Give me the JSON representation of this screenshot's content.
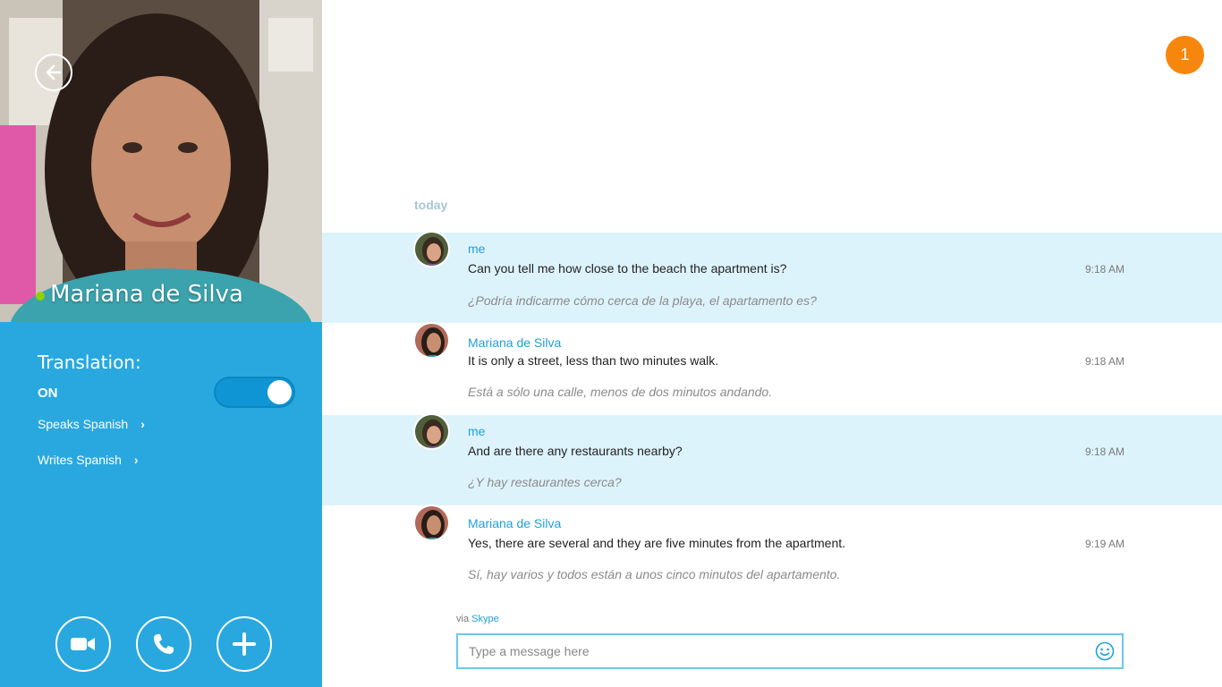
{
  "contact": {
    "name": "Mariana de Silva",
    "presence_color": "#8ed100"
  },
  "translation": {
    "label": "Translation:",
    "state_label": "ON",
    "enabled": true,
    "speaks_label": "Speaks Spanish",
    "writes_label": "Writes Spanish"
  },
  "notifications": {
    "count": "1"
  },
  "conversation": {
    "date_separator": "today",
    "messages": [
      {
        "sender": "me",
        "text": "Can you tell me how close to the beach the apartment is?",
        "translation": "¿Podría indicarme cómo cerca de la playa, el apartamento es?",
        "time": "9:18 AM"
      },
      {
        "sender": "Mariana de Silva",
        "text": "It is only a street, less than two minutes walk.",
        "translation": "Está a sólo una calle, menos de dos minutos andando.",
        "time": "9:18 AM"
      },
      {
        "sender": "me",
        "text": "And are there any restaurants nearby?",
        "translation": "¿Y hay restaurantes cerca?",
        "time": "9:18 AM"
      },
      {
        "sender": "Mariana de Silva",
        "text": "Yes, there are several and they are five minutes from the apartment.",
        "translation": "Sí, hay varios y todos están a unos cinco minutos del apartamento.",
        "time": "9:19 AM"
      }
    ]
  },
  "compose": {
    "via_prefix": "via",
    "via_service": "Skype",
    "placeholder": "Type a message here"
  },
  "colors": {
    "accent": "#29a8e0",
    "my_message_bg": "#ddf3fc",
    "badge": "#f7870c"
  }
}
